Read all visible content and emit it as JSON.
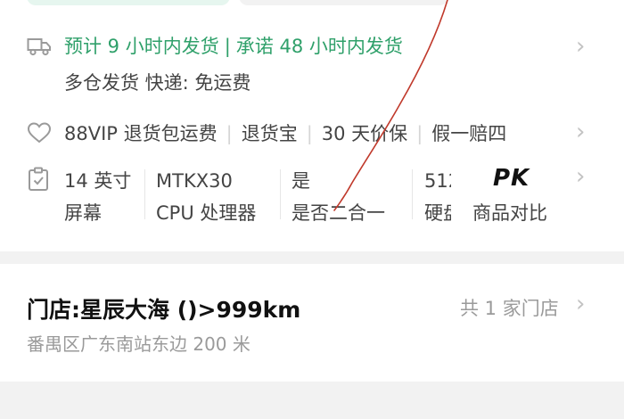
{
  "shipping": {
    "estimate": "预计 9 小时内发货",
    "promise": "承诺 48 小时内发货",
    "detail": "多仓发货 快递: 免运费"
  },
  "services": [
    "88VIP 退货包运费",
    "退货宝",
    "30 天价保",
    "假一赔四"
  ],
  "specs": [
    {
      "value": "14 英寸",
      "label": "屏幕"
    },
    {
      "value": "MTKX30",
      "label": "CPU 处理器"
    },
    {
      "value": "是",
      "label": "是否二合一"
    },
    {
      "value": "512",
      "label": "硬盘"
    }
  ],
  "compare": {
    "logo": "PK",
    "label": "商品对比"
  },
  "store": {
    "name": "门店:星辰大海 ()>999km",
    "address": "番禺区广东南站东边 200 米",
    "count": "共 1 家门店"
  },
  "colors": {
    "accent_green": "#2fa06a",
    "annotation_red": "#c0392b"
  },
  "icons": [
    "truck-icon",
    "heart-icon",
    "clipboard-icon",
    "chevron-right-icon"
  ]
}
